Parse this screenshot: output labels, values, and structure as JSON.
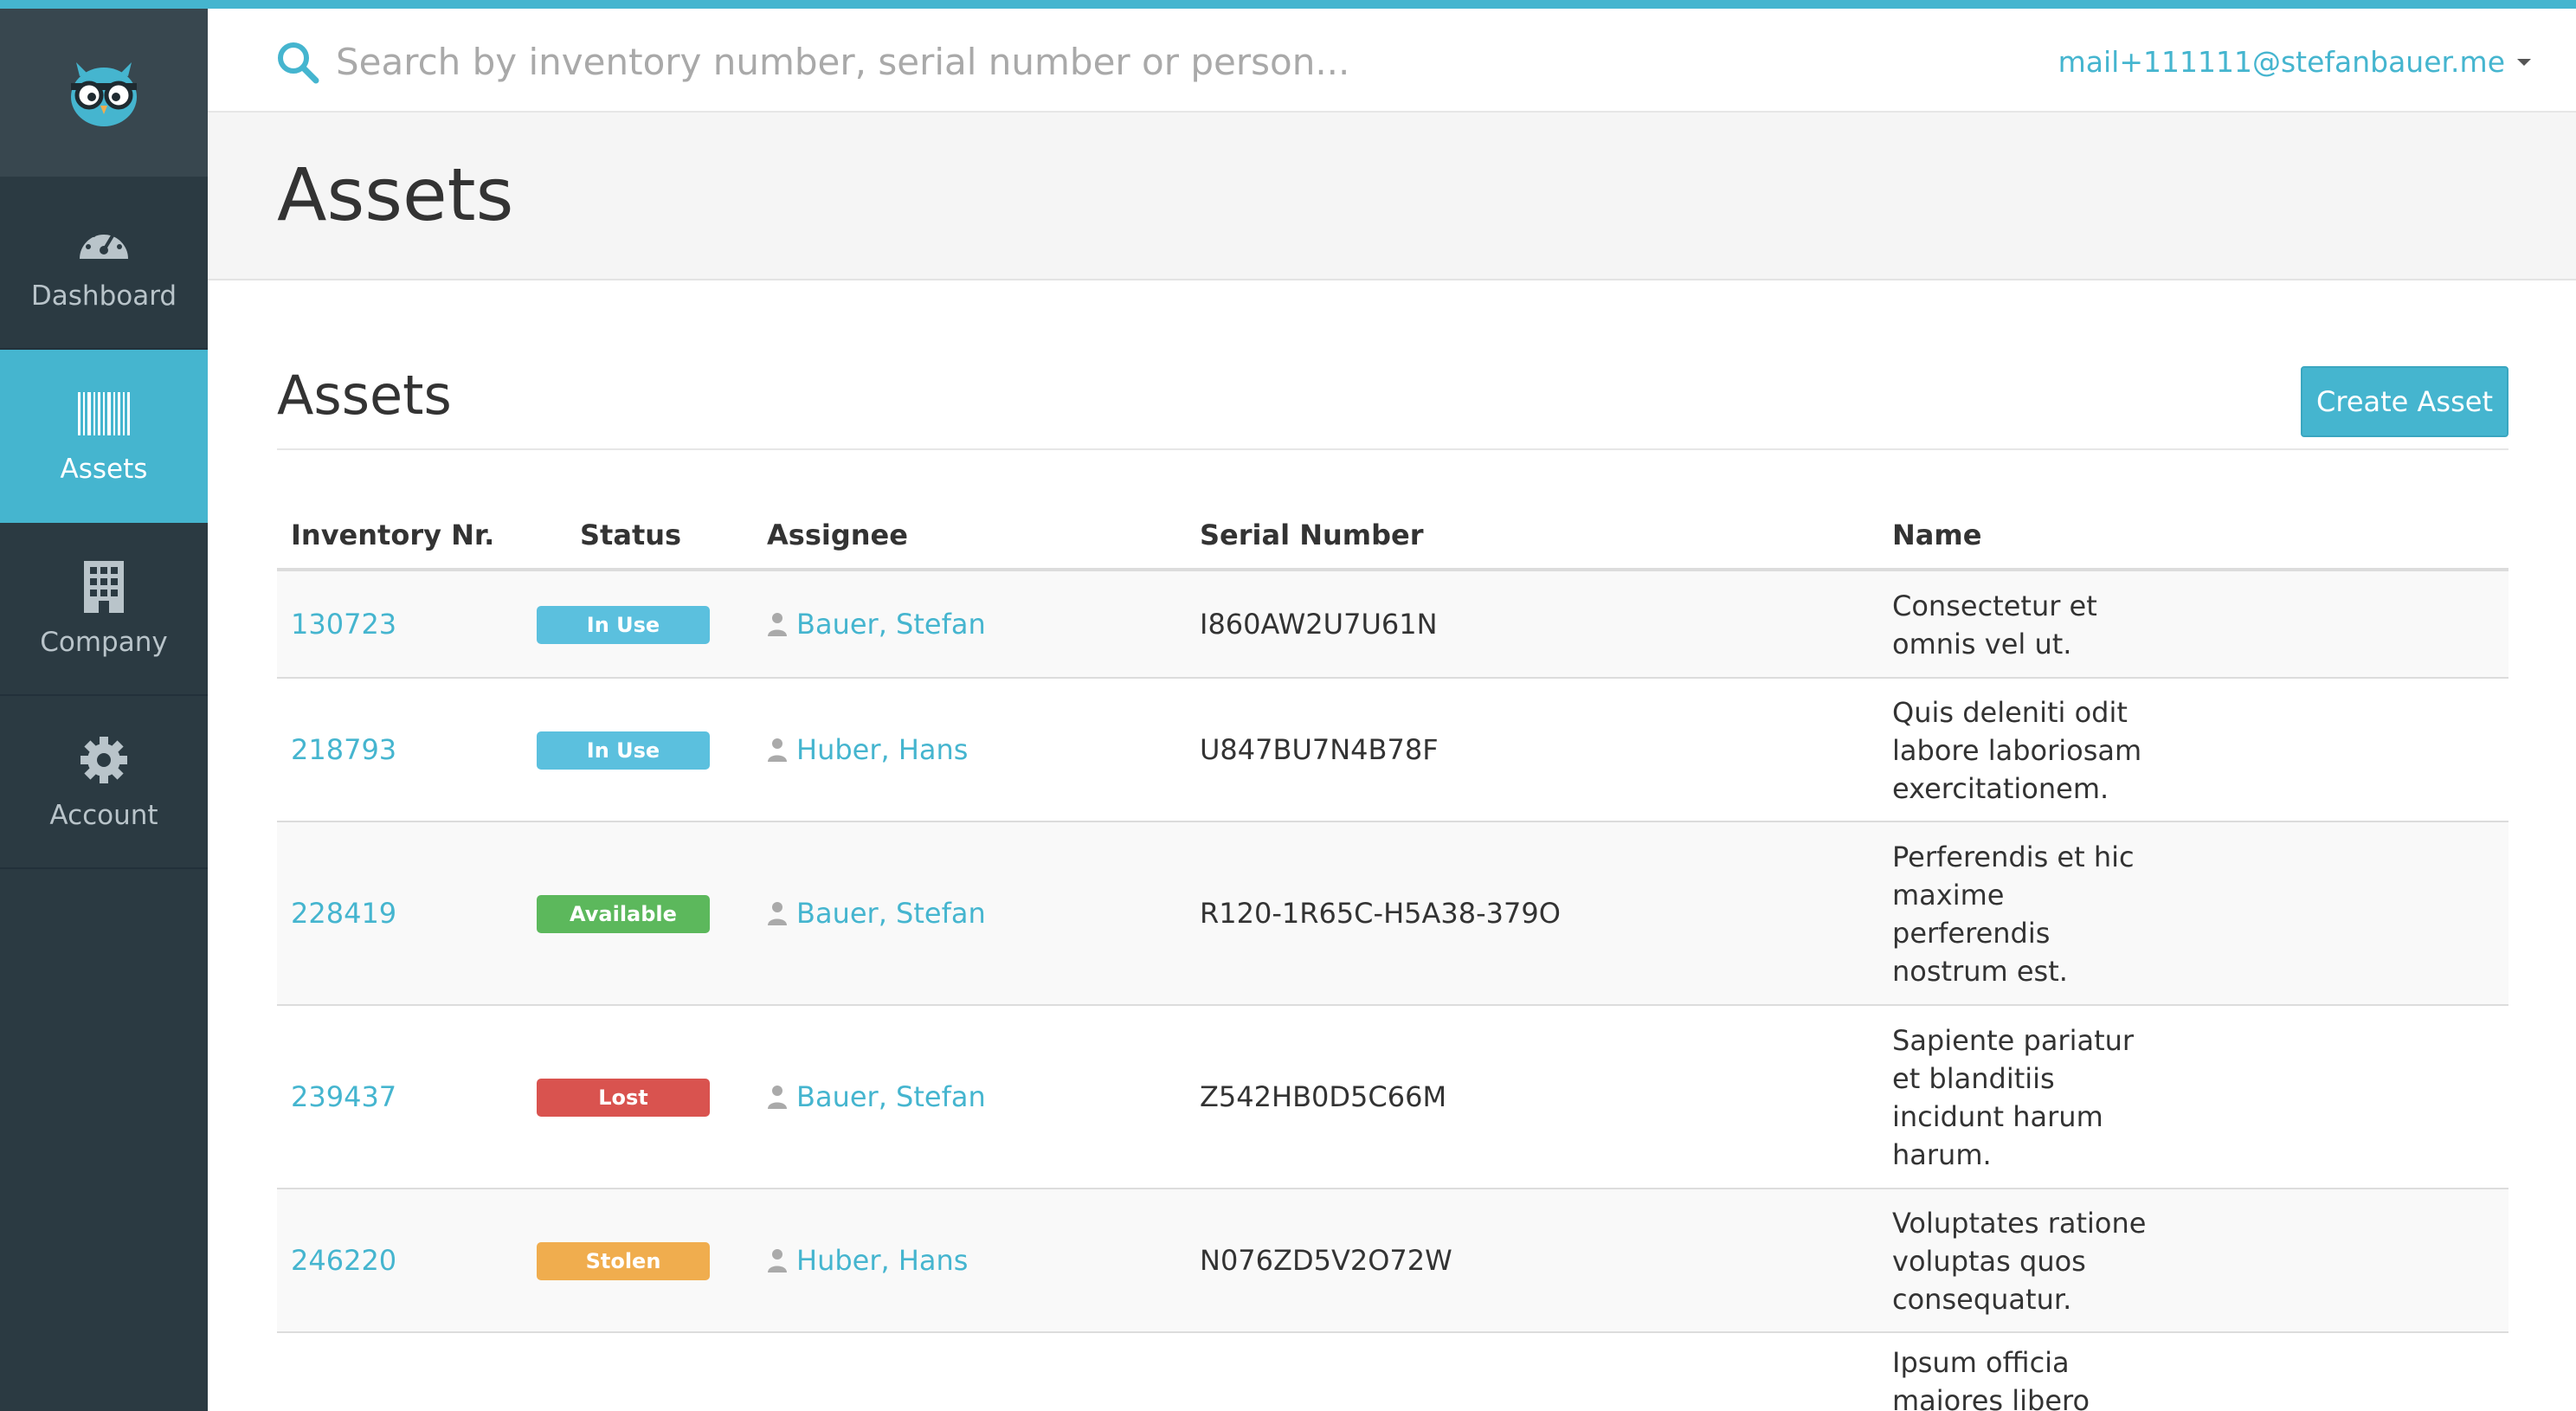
{
  "search": {
    "placeholder": "Search by inventory number, serial number or person..."
  },
  "user": {
    "email": "mail+111111@stefanbauer.me"
  },
  "sidebar": {
    "items": [
      {
        "label": "Dashboard",
        "icon": "dashboard-gauge-icon",
        "active": false
      },
      {
        "label": "Assets",
        "icon": "barcode-icon",
        "active": true
      },
      {
        "label": "Company",
        "icon": "building-icon",
        "active": false
      },
      {
        "label": "Account",
        "icon": "gear-icon",
        "active": false
      }
    ]
  },
  "page": {
    "title": "Assets"
  },
  "main": {
    "section_title": "Assets",
    "create_label": "Create Asset"
  },
  "table": {
    "headers": [
      "Inventory Nr.",
      "Status",
      "Assignee",
      "Serial Number",
      "Name"
    ],
    "rows": [
      {
        "inventory": "130723",
        "status": "In Use",
        "assignee": "Bauer, Stefan",
        "serial": "I860AW2U7U61N",
        "name": [
          "Consectetur et",
          "omnis vel ut."
        ]
      },
      {
        "inventory": "218793",
        "status": "In Use",
        "assignee": "Huber, Hans",
        "serial": "U847BU7N4B78F",
        "name": [
          "Quis deleniti odit",
          "labore laboriosam",
          "exercitationem."
        ]
      },
      {
        "inventory": "228419",
        "status": "Available",
        "assignee": "Bauer, Stefan",
        "serial": "R120-1R65C-H5A38-379O",
        "name": [
          "Perferendis et hic",
          "maxime",
          "perferendis",
          "nostrum est."
        ]
      },
      {
        "inventory": "239437",
        "status": "Lost",
        "assignee": "Bauer, Stefan",
        "serial": "Z542HB0D5C66M",
        "name": [
          "Sapiente pariatur",
          "et blanditiis",
          "incidunt harum",
          "harum."
        ]
      },
      {
        "inventory": "246220",
        "status": "Stolen",
        "assignee": "Huber, Hans",
        "serial": "N076ZD5V2O72W",
        "name": [
          "Voluptates ratione",
          "voluptas quos",
          "consequatur."
        ]
      },
      {
        "inventory": "",
        "status": "",
        "assignee": "",
        "serial": "",
        "name": [
          "Ipsum officia",
          "maiores libero"
        ]
      }
    ]
  },
  "status_colors": {
    "In Use": "#5bc0de",
    "Available": "#5cb85c",
    "Lost": "#d9534f",
    "Stolen": "#f0ad4e"
  },
  "colors": {
    "accent": "#45b5cf",
    "sidebar": "#2b3a42"
  }
}
